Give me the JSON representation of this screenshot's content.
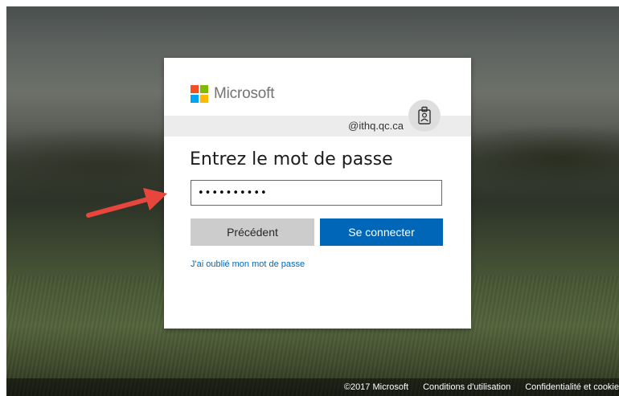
{
  "brand": {
    "name": "Microsoft",
    "colors": [
      "#f25022",
      "#7fba00",
      "#00a4ef",
      "#ffb900"
    ]
  },
  "identity": {
    "email": "@ithq.qc.ca",
    "avatar_icon": "badge-icon"
  },
  "form": {
    "title": "Entrez le mot de passe",
    "password_value": "••••••••••",
    "back_label": "Précédent",
    "signin_label": "Se connecter",
    "forgot_label": "J'ai oublié mon mot de passe"
  },
  "footer": {
    "copyright": "©2017 Microsoft",
    "terms": "Conditions d'utilisation",
    "privacy": "Confidentialité et cookie"
  },
  "colors": {
    "accent": "#0067b8",
    "annotation_arrow": "#e8453c"
  }
}
